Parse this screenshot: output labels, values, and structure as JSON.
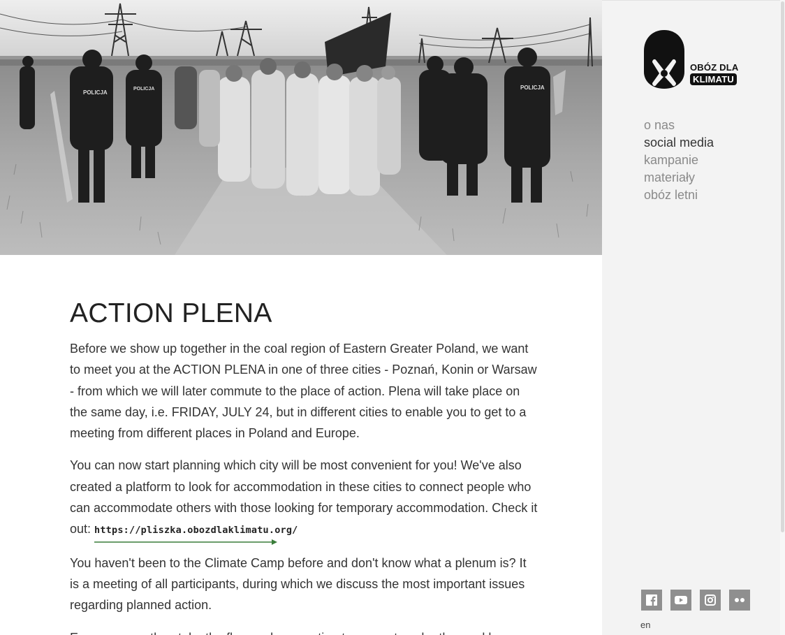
{
  "hero": {
    "police_label": "POLICJA"
  },
  "article": {
    "title": "ACTION PLENA",
    "paragraphs": [
      "Before we show up together in the coal region of Eastern Greater Poland, we want to meet you at the ACTION PLENA in one of three cities - Poznań, Konin or Warsaw - from which we will later commute to the place of action. Plena will take place on the same day, i.e. FRIDAY, JULY 24, but in different cities to enable you to get to a meeting from different places in Poland and Europe.",
      "You can now start planning which city will be most convenient for you! We've also created a platform to look for accommodation in these cities to connect people who can accommodate others with those looking for temporary accommodation. Check it out: ",
      "You haven't been to the Climate Camp before and don't know what a plenum is? It is a meeting of all participants, during which we discuss the most important issues regarding planned action.",
      "Everyone can then take the floor, ask a question to support each other and have"
    ],
    "link_text": "https://pliszka.obozdlaklimatu.org/",
    "link_color": "#3a7d3a"
  },
  "sidebar": {
    "logo": {
      "line1": "OBÓZ DLA",
      "line2": "KLIMATU"
    },
    "nav": [
      {
        "label": "o nas"
      },
      {
        "label": "social media"
      },
      {
        "label": "kampanie"
      },
      {
        "label": "materiały"
      },
      {
        "label": "obóz letni"
      }
    ],
    "social": [
      {
        "icon": "facebook-icon"
      },
      {
        "icon": "youtube-icon"
      },
      {
        "icon": "instagram-icon"
      },
      {
        "icon": "flickr-icon"
      }
    ],
    "language": "en"
  },
  "colors": {
    "sidebar_bg": "#f3f3f3",
    "nav_inactive": "#8a8a8a",
    "nav_active": "#333333",
    "social_bg": "#8f8f8f"
  }
}
